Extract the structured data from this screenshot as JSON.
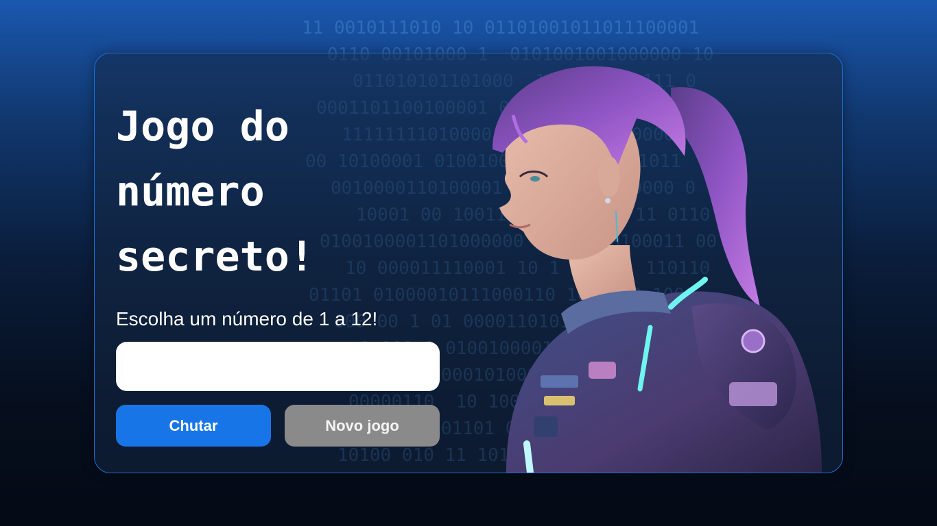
{
  "game": {
    "title": "Jogo do\nnúmero\nsecreto!",
    "instruction": "Escolha um número de 1 a 12!",
    "input_value": "",
    "input_placeholder": "",
    "guess_button_label": "Chutar",
    "new_game_button_label": "Novo jogo"
  },
  "background": {
    "binary_rows": [
      "11 0010111010 10 01101001011011100001",
      "0110 00101000 1  0101001001000000 10",
      "011010101101000  100 0 1101111 0",
      "0001101100100001 00 01100011101000010",
      "11111111010000   0 1000 0 1000011 0 0",
      "00 10100001 0100100001 100 0 001011",
      "0010000110100001 0001 0 01 00000 0",
      "10001 00 10011100011 1 01 11 0110",
      "0100100001101000000 0 1101 0100011 00",
      "10 000011110001 10 1 10 0 1 110110",
      "01101 01000010111000110 1001 10 1000",
      "000 00 1 01 00001101010 00101100110",
      "0 000 0 0100100001101000010 0  0",
      "00 0 100 10000101000010 0 0  11 100",
      "00000110  10 10000 011 01 0 10 0",
      "00 01111   101101 00 1 1 1 1 0",
      "10100 010 11 10110100010100101 010 0110"
    ]
  },
  "colors": {
    "background_top": "#1a58b0",
    "background_bottom": "#040a15",
    "container_border": "#1f6fd6",
    "guess_button": "#1875e8",
    "new_game_button": "#8a8a8a",
    "hair_purple": "#a25ed6",
    "suit_cyan": "#6ff5f0"
  },
  "images": {
    "hero": "female-astronaut-portrait-illustration"
  }
}
